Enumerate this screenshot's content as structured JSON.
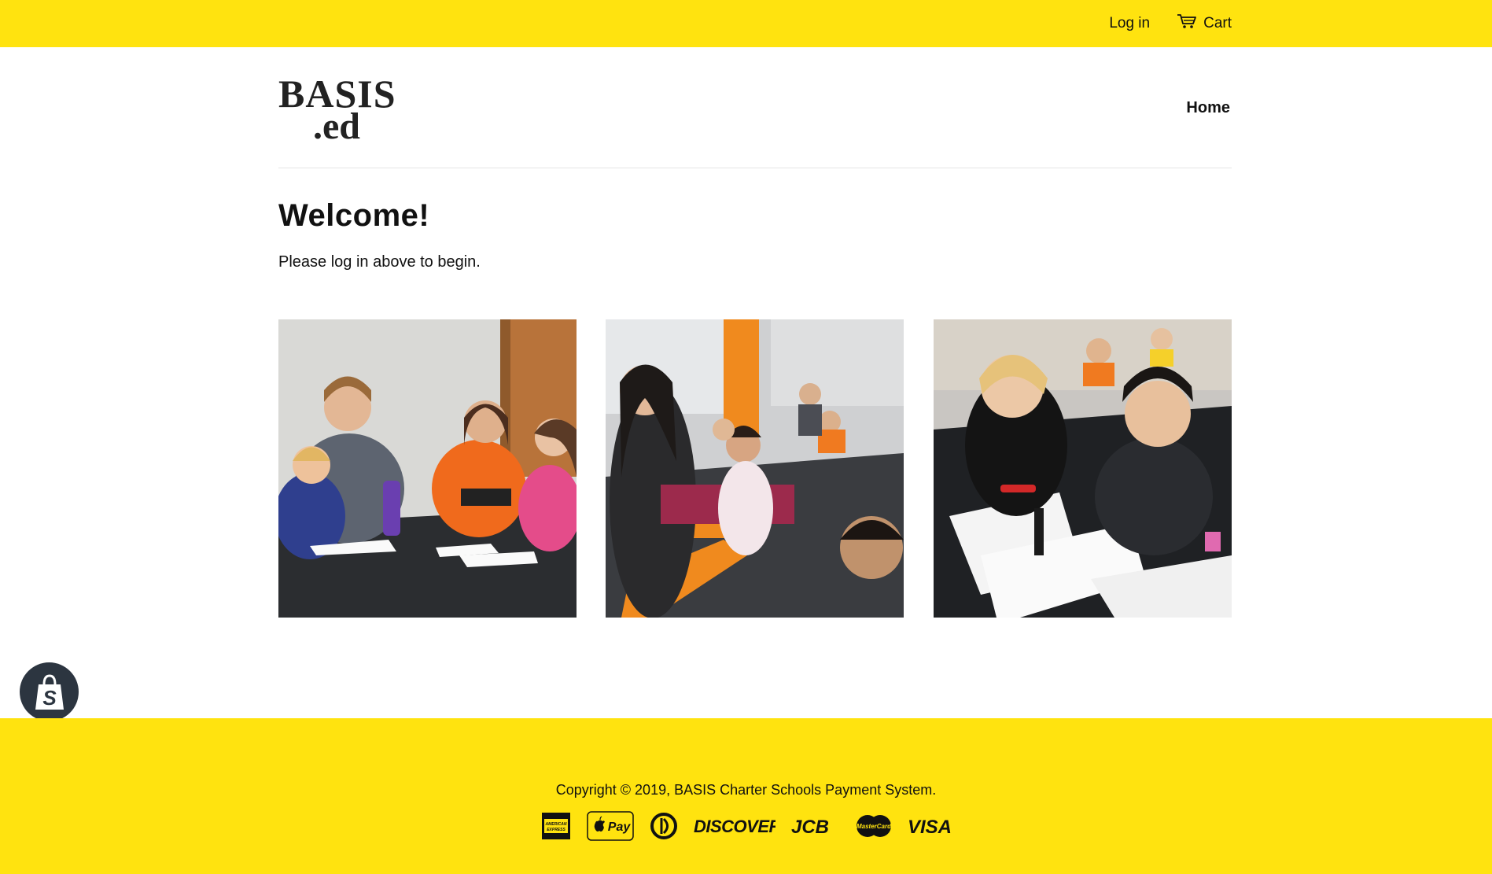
{
  "topbar": {
    "login_label": "Log in",
    "cart_label": "Cart",
    "cart_icon": "cart-icon",
    "background": "#ffe30f"
  },
  "header": {
    "logo_text_line1": "BASIS",
    "logo_text_line2": ".ed",
    "nav_home_label": "Home"
  },
  "main": {
    "title": "Welcome!",
    "subtitle": "Please log in above to begin."
  },
  "gallery": {
    "photos": [
      {
        "name": "classroom-photo-teacher-group"
      },
      {
        "name": "classroom-photo-teacher-row"
      },
      {
        "name": "classroom-photo-calligraphy"
      }
    ]
  },
  "shopify_badge": {
    "icon": "shopify-bag-icon"
  },
  "footer": {
    "copyright": "Copyright © 2019, BASIS Charter Schools Payment System.",
    "payments": [
      {
        "name": "american-express-icon",
        "label": "AMERICAN EXPRESS"
      },
      {
        "name": "apple-pay-icon",
        "label": "Pay"
      },
      {
        "name": "diners-club-icon",
        "label": ""
      },
      {
        "name": "discover-icon",
        "label": "DISCOVER"
      },
      {
        "name": "jcb-icon",
        "label": "JCB"
      },
      {
        "name": "mastercard-icon",
        "label": "MasterCard"
      },
      {
        "name": "visa-icon",
        "label": "VISA"
      }
    ]
  }
}
